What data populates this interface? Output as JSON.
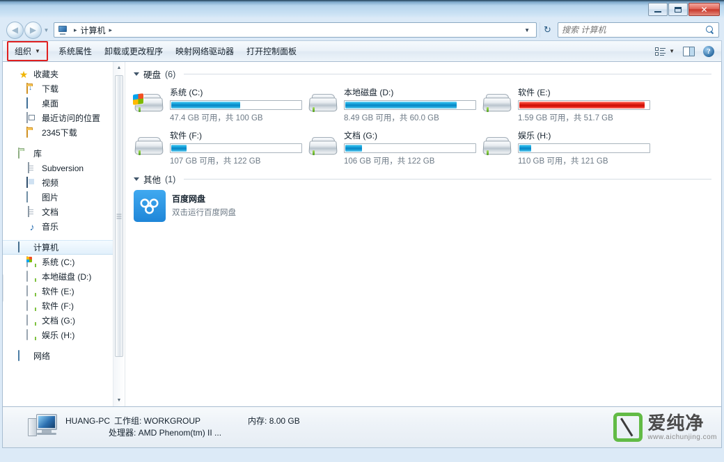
{
  "window": {
    "minimize_label": "最小化",
    "maximize_label": "最大化",
    "close_label": "✕"
  },
  "address": {
    "crumb_root": "计算机",
    "back_glyph": "◀",
    "forward_glyph": "▶",
    "dropdown_glyph": "▼",
    "refresh_glyph": "↻",
    "sep_glyph": "▸"
  },
  "search": {
    "placeholder": "搜索 计算机",
    "value": ""
  },
  "toolbar": {
    "organize": "组织",
    "caret": "▼",
    "items": [
      {
        "label": "系统属性"
      },
      {
        "label": "卸载或更改程序"
      },
      {
        "label": "映射网络驱动器"
      },
      {
        "label": "打开控制面板"
      }
    ],
    "help_glyph": "?"
  },
  "sidebar": {
    "groups": [
      {
        "name": "收藏夹",
        "icon": "star-icon",
        "items": [
          {
            "label": "下载",
            "icon": "folder-download-icon"
          },
          {
            "label": "桌面",
            "icon": "desktop-icon"
          },
          {
            "label": "最近访问的位置",
            "icon": "recent-places-icon"
          },
          {
            "label": "2345下载",
            "icon": "folder-icon"
          }
        ]
      },
      {
        "name": "库",
        "icon": "library-icon",
        "items": [
          {
            "label": "Subversion",
            "icon": "document-icon"
          },
          {
            "label": "视频",
            "icon": "video-icon"
          },
          {
            "label": "图片",
            "icon": "picture-icon"
          },
          {
            "label": "文档",
            "icon": "document-icon"
          },
          {
            "label": "音乐",
            "icon": "music-icon"
          }
        ]
      },
      {
        "name": "计算机",
        "icon": "computer-icon",
        "selected": true,
        "items": [
          {
            "label": "系统 (C:)",
            "icon": "hdd-windows-icon"
          },
          {
            "label": "本地磁盘 (D:)",
            "icon": "hdd-icon"
          },
          {
            "label": "软件 (E:)",
            "icon": "hdd-icon"
          },
          {
            "label": "软件 (F:)",
            "icon": "hdd-icon"
          },
          {
            "label": "文档 (G:)",
            "icon": "hdd-icon"
          },
          {
            "label": "娱乐 (H:)",
            "icon": "hdd-icon"
          }
        ]
      },
      {
        "name": "网络",
        "icon": "network-icon",
        "items": []
      }
    ],
    "scroll_up_glyph": "▲",
    "scroll_down_glyph": "▼"
  },
  "content": {
    "groups": [
      {
        "label": "硬盘",
        "count": "(6)"
      },
      {
        "label": "其他",
        "count": "(1)"
      }
    ],
    "drives": [
      {
        "name": "系统 (C:)",
        "free_text": "47.4 GB 可用，共 100 GB",
        "used_percent": 53,
        "bar_color": "blue",
        "icon": "hdd-windows-icon"
      },
      {
        "name": "本地磁盘 (D:)",
        "free_text": "8.49 GB 可用，共 60.0 GB",
        "used_percent": 86,
        "bar_color": "blue",
        "icon": "hdd-icon"
      },
      {
        "name": "软件 (E:)",
        "free_text": "1.59 GB 可用，共 51.7 GB",
        "used_percent": 97,
        "bar_color": "red",
        "icon": "hdd-icon"
      },
      {
        "name": "软件 (F:)",
        "free_text": "107 GB 可用，共 122 GB",
        "used_percent": 12,
        "bar_color": "blue",
        "icon": "hdd-icon"
      },
      {
        "name": "文档 (G:)",
        "free_text": "106 GB 可用，共 122 GB",
        "used_percent": 13,
        "bar_color": "blue",
        "icon": "hdd-icon"
      },
      {
        "name": "娱乐 (H:)",
        "free_text": "110 GB 可用，共 121 GB",
        "used_percent": 9,
        "bar_color": "blue",
        "icon": "hdd-icon"
      }
    ],
    "other": {
      "title": "百度网盘",
      "description": "双击运行百度网盘",
      "icon": "baidu-netdisk-icon"
    }
  },
  "status": {
    "computer_name": "HUANG-PC",
    "workgroup": "工作组: WORKGROUP",
    "memory": "内存: 8.00 GB",
    "processor": "处理器: AMD Phenom(tm) II ..."
  },
  "watermark": {
    "text": "爱纯净",
    "url": "www.aichunjing.com"
  },
  "colors": {
    "accent_blue": "#0a86c4",
    "warning_red": "#ca0f08",
    "highlight_box": "#e02020",
    "watermark_green": "#62bb46"
  }
}
